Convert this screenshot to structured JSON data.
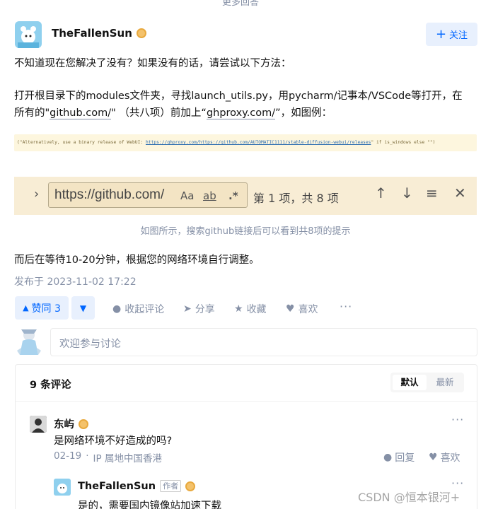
{
  "more_answers": "更多回答",
  "answer": {
    "author": "TheFallenSun",
    "follow_label": "关注",
    "intro": "不知道现在您解决了没有？如果没有的话，请尝试以下方法：",
    "step_line1": "打开根目录下的modules文件夹，寻找launch_utils.py，用pycharm/记事本/VSCode等打开，在",
    "step_line2_pre": "所有的\"",
    "step_link1": "github.com/",
    "step_line2_mid": "\" （共八项）前加上“",
    "step_link2": "ghproxy.com/",
    "step_line2_post": "”，如图例：",
    "code_pre": "(\"Alternatively, use a binary release of WebUI: ",
    "code_link": "https://ghproxy.com/https://github.com/AUTOMATIC1111/stable-diffusion-webui/releases",
    "code_post": "\" if is_windows else \"\")",
    "find_text": "https://github.com/",
    "find_opt_case": "Aa",
    "find_opt_word": "ab",
    "find_opt_regex": ".*",
    "find_count": "第 1 项，共 8 项",
    "caption": "如图所示，搜索github链接后可以看到共8项的提示",
    "closing": "而后在等待10-20分钟，根据您的网络环境自行调整。",
    "published": "发布于 2023-11-02 17:22",
    "vote_label": "赞同 3",
    "actions": {
      "collapse_comments": "收起评论",
      "share": "分享",
      "favorite": "收藏",
      "like": "喜欢"
    }
  },
  "comment_placeholder": "欢迎参与讨论",
  "comments": {
    "count_label": "9 条评论",
    "sort_default": "默认",
    "sort_latest": "最新",
    "items": [
      {
        "author": "东屿",
        "text": "是网络环境不好造成的吗?",
        "date": "02-19",
        "location": "IP 属地中国香港",
        "reply_label": "回复",
        "like_label": "喜欢"
      },
      {
        "author": "TheFallenSun",
        "author_tag": "作者",
        "text": "是的，需要国内镜像站加速下载"
      }
    ]
  },
  "watermark": "CSDN @恒本银河+",
  "colors": {
    "accent": "#0066ff",
    "accent_bg": "#e8f0fd",
    "muted": "#8590a6"
  }
}
